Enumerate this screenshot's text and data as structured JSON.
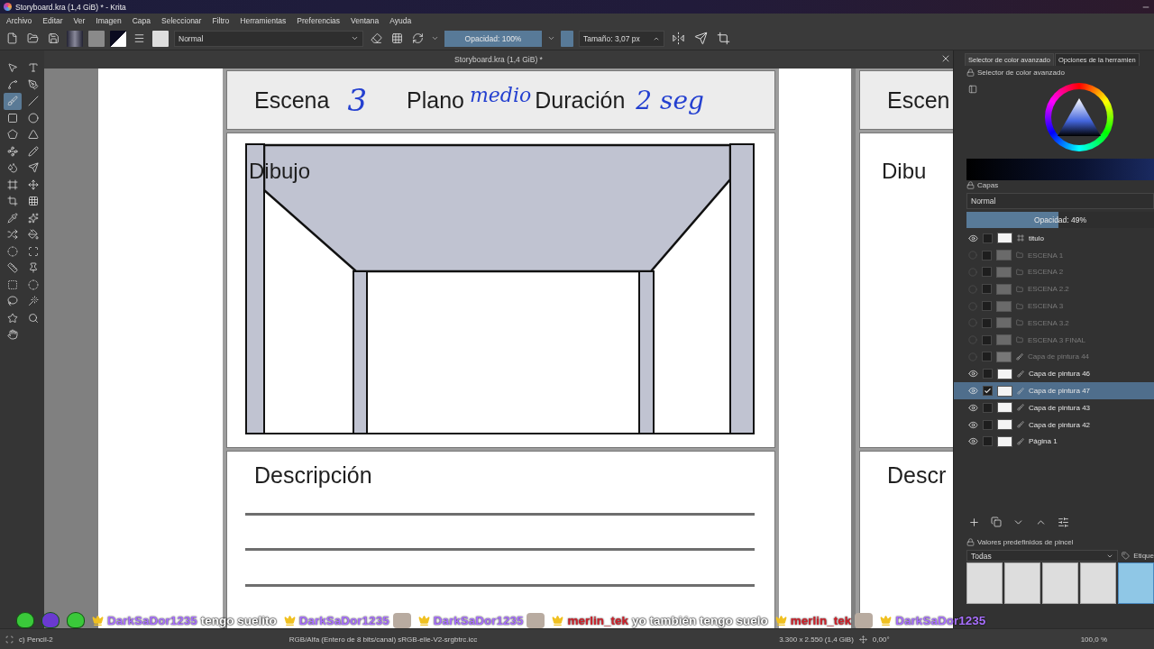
{
  "window": {
    "title": "Storyboard.kra (1,4 GiB) * - Krita"
  },
  "menu": [
    "Archivo",
    "Editar",
    "Ver",
    "Imagen",
    "Capa",
    "Seleccionar",
    "Filtro",
    "Herramientas",
    "Preferencias",
    "Ventana",
    "Ayuda"
  ],
  "toolbar": {
    "blend_mode": "Normal",
    "opacity": {
      "label": "Opacidad: 100%",
      "level": 1
    },
    "size": "Tamaño: 3,07 px"
  },
  "tools": [
    {
      "selected": false
    },
    {
      "selected": false
    },
    {
      "selected": false
    },
    {
      "selected": false
    },
    {
      "selected": true
    },
    {
      "selected": false
    },
    {
      "selected": false
    },
    {
      "selected": false
    },
    {
      "selected": false
    },
    {
      "selected": false
    },
    {
      "selected": false
    },
    {
      "selected": false
    },
    {
      "selected": false
    },
    {
      "selected": false
    },
    {
      "selected": false
    },
    {
      "selected": false
    },
    {
      "selected": false
    },
    {
      "selected": false
    },
    {
      "selected": false
    },
    {
      "selected": false
    },
    {
      "selected": false
    },
    {
      "selected": false
    },
    {
      "selected": false
    },
    {
      "selected": false
    },
    {
      "selected": false
    },
    {
      "selected": false
    },
    {
      "selected": false
    },
    {
      "selected": false
    },
    {
      "selected": false
    },
    {
      "selected": false
    },
    {
      "selected": false
    },
    {
      "selected": false
    },
    {
      "selected": false
    }
  ],
  "document_tab": "Storyboard.kra (1,4 GiB) *",
  "storyboard": {
    "scene_label": "Escena",
    "scene_value": "3",
    "shot_label": "Plano",
    "shot_value": "medio",
    "duration_label": "Duración",
    "duration_value": "2 seg",
    "drawing_label": "Dibujo",
    "description_label": "Descripción"
  },
  "next_page": {
    "scene_label": "Escen",
    "drawing_label": "Dibu",
    "description_label": "Descr"
  },
  "dock_tabs": [
    {
      "label": "Selector de color avanzado",
      "selected": true
    },
    {
      "label": "Opciones de la herramien",
      "selected": false
    }
  ],
  "color_selector": {
    "title": "Selector de color avanzado"
  },
  "layers": {
    "title": "Capas",
    "blend_mode": "Normal",
    "opacity": {
      "label": "Opacidad: 49%",
      "level": 0.49
    },
    "items": [
      {
        "name": "titulo",
        "kind": "vector",
        "visible": true,
        "checked": false,
        "selected": false
      },
      {
        "name": "ESCENA 1",
        "kind": "group",
        "visible": false,
        "checked": false,
        "selected": false
      },
      {
        "name": "ESCENA 2",
        "kind": "group",
        "visible": false,
        "checked": false,
        "selected": false
      },
      {
        "name": "ESCENA 2.2",
        "kind": "group",
        "visible": false,
        "checked": false,
        "selected": false
      },
      {
        "name": "ESCENA 3",
        "kind": "group",
        "visible": false,
        "checked": false,
        "selected": false
      },
      {
        "name": "ESCENA 3.2",
        "kind": "group",
        "visible": false,
        "checked": false,
        "selected": false
      },
      {
        "name": "ESCENA 3 FINAL",
        "kind": "group",
        "visible": false,
        "checked": false,
        "selected": false
      },
      {
        "name": "Capa de pintura 44",
        "kind": "paint",
        "visible": false,
        "checked": false,
        "selected": false
      },
      {
        "name": "Capa de pintura 46",
        "kind": "paint",
        "visible": true,
        "checked": false,
        "selected": false
      },
      {
        "name": "Capa de pintura 47",
        "kind": "paint",
        "visible": true,
        "checked": true,
        "selected": true
      },
      {
        "name": "Capa de pintura 43",
        "kind": "paint",
        "visible": true,
        "checked": false,
        "selected": false
      },
      {
        "name": "Capa de pintura 42",
        "kind": "paint",
        "visible": true,
        "checked": false,
        "selected": false
      },
      {
        "name": "Página 1",
        "kind": "paint",
        "visible": true,
        "checked": false,
        "selected": false
      }
    ]
  },
  "brush_presets": {
    "title": "Valores predefinidos de pincel",
    "filter": "Todas",
    "tag_label": "Etique",
    "items": [
      {
        "selected": false
      },
      {
        "selected": false
      },
      {
        "selected": false
      },
      {
        "selected": false
      },
      {
        "selected": true
      }
    ]
  },
  "chat": [
    {
      "user": "DarkSaDor1235",
      "color": "#a970ff",
      "emote": false,
      "text": "tengo suelito"
    },
    {
      "user": "DarkSaDor1235",
      "color": "#a970ff",
      "emote": true
    },
    {
      "user": "DarkSaDor1235",
      "color": "#a970ff",
      "emote": true
    },
    {
      "user": "merlin_tek",
      "color": "#d0202a",
      "emote": false,
      "text": "yo también tengo suelo"
    },
    {
      "user": "merlin_tek",
      "color": "#d0202a",
      "emote": true
    },
    {
      "user": "DarkSaDor1235",
      "color": "#a970ff",
      "emote": false
    }
  ],
  "status_bar": {
    "brush": "c) Pencil-2",
    "color_space": "RGB/Alfa (Entero de 8 bits/canal)  sRGB-elle-V2-srgbtrc.icc",
    "image_size": "3.300 x 2.550 (1,4 GiB)",
    "rotation": "0,00°",
    "zoom": "100,0 %"
  }
}
